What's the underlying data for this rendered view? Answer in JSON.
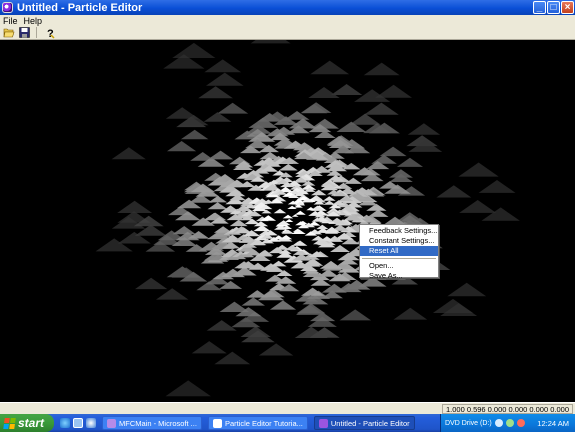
{
  "window": {
    "title": "Untitled - Particle Editor",
    "controls": [
      "minimize",
      "maximize",
      "close"
    ]
  },
  "menubar": {
    "items": [
      {
        "label": "File"
      },
      {
        "label": "Help"
      }
    ]
  },
  "toolbar": {
    "buttons": [
      {
        "icon": "open-folder-icon"
      },
      {
        "icon": "save-disk-icon"
      },
      {
        "icon": "help-question-icon"
      }
    ]
  },
  "context_menu": {
    "items": [
      {
        "label": "Feedback Settings..."
      },
      {
        "label": "Constant Settings..."
      },
      {
        "label": "Reset All",
        "highlighted": true
      },
      {
        "label": "Open..."
      },
      {
        "label": "Save As..."
      }
    ]
  },
  "statusbar": {
    "values": "1.000 0.596 0.000 0.000 0.000 0.000"
  },
  "taskbar": {
    "start_label": "start",
    "tasks": [
      {
        "label": "MFCMain - Microsoft ..."
      },
      {
        "label": "Particle Editor Tutoria..."
      },
      {
        "label": "Untitled - Particle Editor",
        "active": true
      }
    ],
    "tray_label": "DVD Drive (D:)",
    "clock": "12:24 AM"
  },
  "colors": {
    "titlebar": "#0a4fd6",
    "menu_highlight": "#316ac5",
    "canvas_bg": "#000000",
    "taskbar": "#245edb",
    "start_button": "#3a9a3a"
  }
}
